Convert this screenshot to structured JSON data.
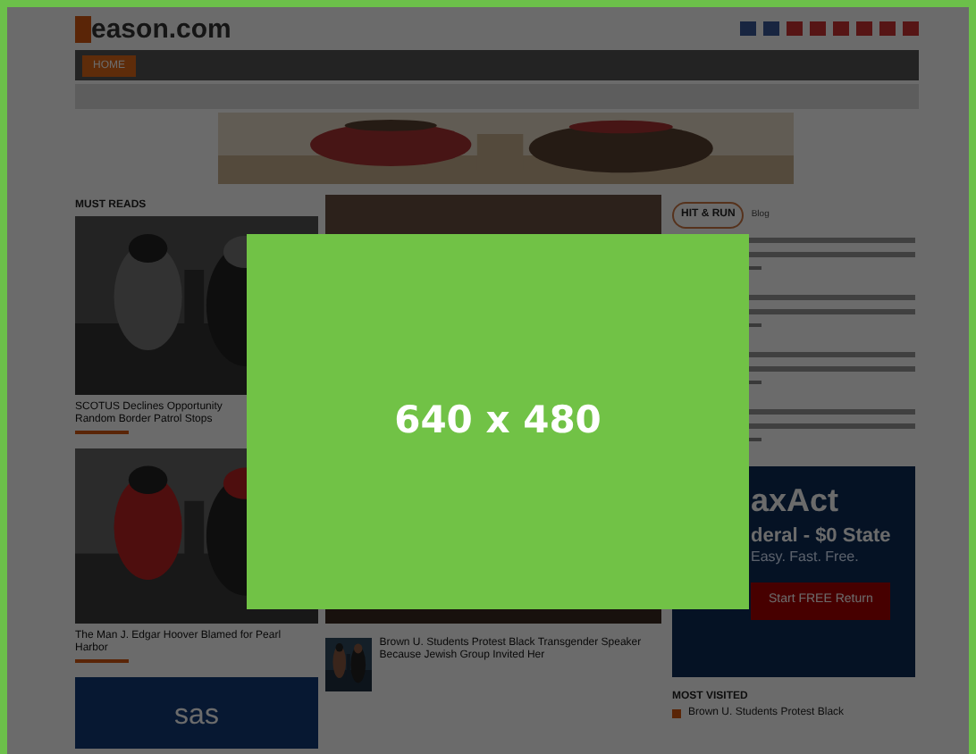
{
  "header": {
    "logo_text": "eason.com"
  },
  "nav": {
    "tabs": [
      {
        "label": "HOME",
        "selected": true
      }
    ]
  },
  "must_reads": {
    "title": "MUST READS",
    "articles": [
      {
        "kind": "picture",
        "lines": [
          "SCOTUS Declines Opportunity",
          "Random Border Patrol Stops"
        ]
      },
      {
        "kind": "picture",
        "lines": [
          "The Man J. Edgar Hoover Blamed for Pearl",
          "Harbor"
        ]
      }
    ],
    "ad_text": "sas"
  },
  "center": {
    "article": {
      "title": "Brown U. Students Protest Black Transgender Speaker Because Jewish Group Invited Her"
    }
  },
  "hit_and_run": {
    "title": "HIT & RUN",
    "subtitle": "Blog"
  },
  "ad": {
    "brand": "axAct",
    "headline": "deral - $0 State",
    "tagline": "Easy. Fast. Free.",
    "button": "Start FREE Return"
  },
  "most_visited": {
    "title": "MOST VISITED",
    "items": [
      {
        "title": "Brown U. Students Protest Black"
      }
    ]
  },
  "overlay": {
    "label": "640 x 480"
  }
}
